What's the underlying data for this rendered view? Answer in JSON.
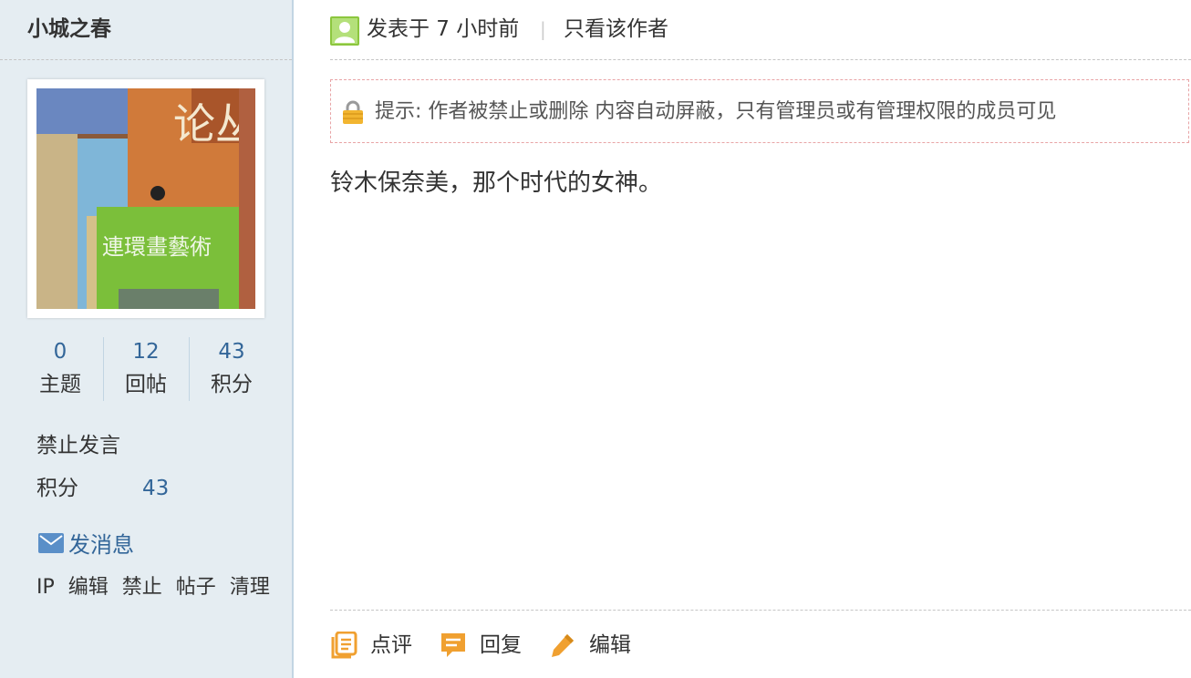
{
  "sidebar": {
    "username": "小城之春",
    "avatar_alt": "连环画艺术",
    "stats": [
      {
        "value": "0",
        "label": "主题"
      },
      {
        "value": "12",
        "label": "回帖"
      },
      {
        "value": "43",
        "label": "积分"
      }
    ],
    "status": "禁止发言",
    "points_label": "积分",
    "points_value": "43",
    "send_message": "发消息",
    "admin_links": [
      "IP",
      "编辑",
      "禁止",
      "帖子",
      "清理"
    ]
  },
  "post": {
    "time": "发表于 7 小时前",
    "separator": "|",
    "author_only": "只看该作者",
    "notice": "提示: 作者被禁止或删除 内容自动屏蔽，只有管理员或有管理权限的成员可见",
    "content": "铃木保奈美，那个时代的女神。",
    "actions": [
      {
        "label": "点评",
        "icon": "comment-icon"
      },
      {
        "label": "回复",
        "icon": "reply-icon"
      },
      {
        "label": "编辑",
        "icon": "edit-icon"
      }
    ]
  },
  "colors": {
    "sidebar_bg": "#e5edf2",
    "link_blue": "#336699",
    "notice_border": "#e8a4a6",
    "action_orange": "#f0a030"
  }
}
